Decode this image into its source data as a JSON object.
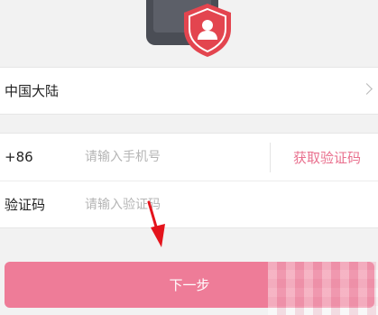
{
  "region": {
    "label": "中国大陆"
  },
  "phone": {
    "prefix": "+86",
    "placeholder": "请输入手机号",
    "get_code_label": "获取验证码"
  },
  "code": {
    "label": "验证码",
    "placeholder": "请输入验证码"
  },
  "next_button": {
    "label": "下一步"
  },
  "icons": {
    "header": "phone-shield-user-icon",
    "region_chevron": "chevron-right-icon",
    "annotation": "red-arrow-icon"
  },
  "colors": {
    "accent": "#e9708e",
    "button": "#ee7c98",
    "shield": "#e3454f",
    "annotation_arrow": "#e4141c"
  }
}
